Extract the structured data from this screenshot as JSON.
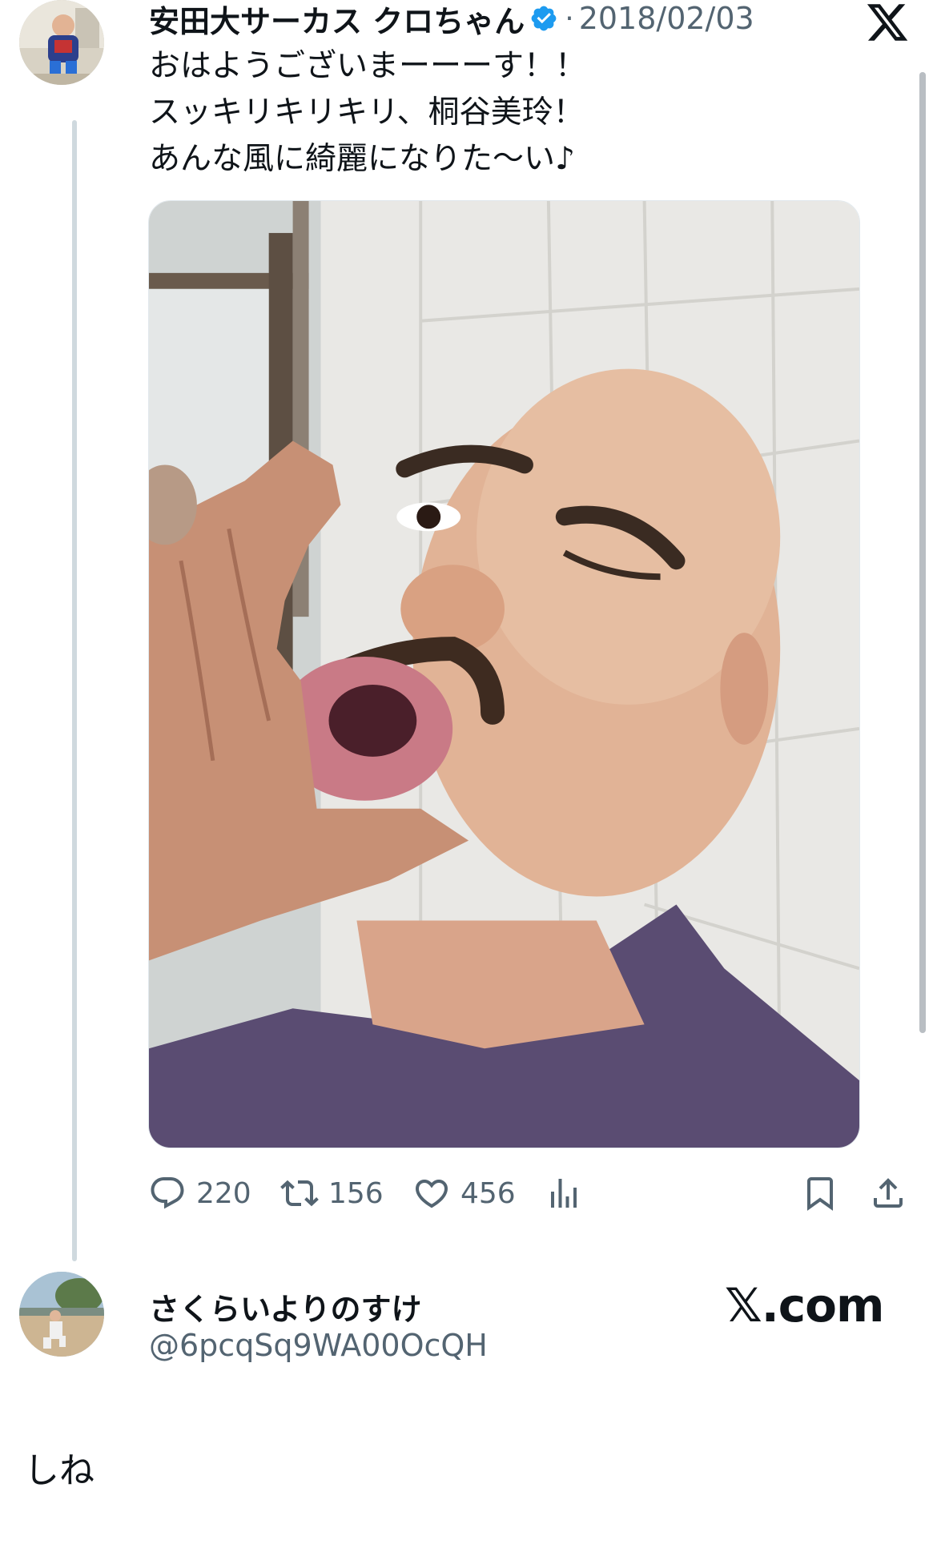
{
  "tweet": {
    "author_name": "安田大サーカス クロちゃん",
    "separator": "·",
    "date": "2018/02/03",
    "verified_icon": "verified-badge-icon",
    "text_lines": [
      "おはようございまーーーす！！",
      "スッキリキリキリ、桐谷美玲！",
      "あんな風に綺麗になりた〜い♪"
    ],
    "media_description_icon": "photo",
    "actions": {
      "reply_count": "220",
      "retweet_count": "156",
      "like_count": "456"
    }
  },
  "reply": {
    "author_name": "さくらいよりのすけ",
    "handle": "@6pcqSq9WA00OcQH",
    "text": "しね"
  },
  "watermark": "𝕏.com",
  "colors": {
    "text_primary": "#0f1419",
    "text_secondary": "#536471",
    "verified_blue": "#1d9bf0",
    "thread_line": "#cfd9de"
  }
}
